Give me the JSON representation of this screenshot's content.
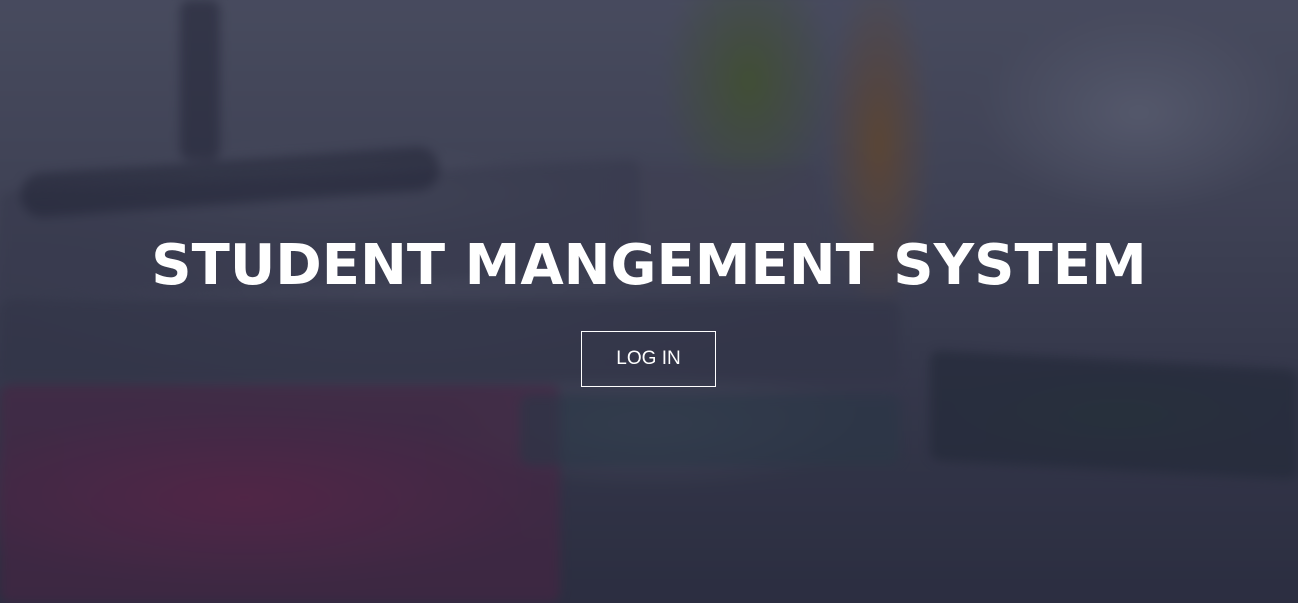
{
  "hero": {
    "title": "STUDENT MANGEMENT SYSTEM",
    "login_label": "LOG IN"
  },
  "colors": {
    "overlay": "#1c1e32",
    "text": "#ffffff",
    "button_border": "#ffffff"
  }
}
